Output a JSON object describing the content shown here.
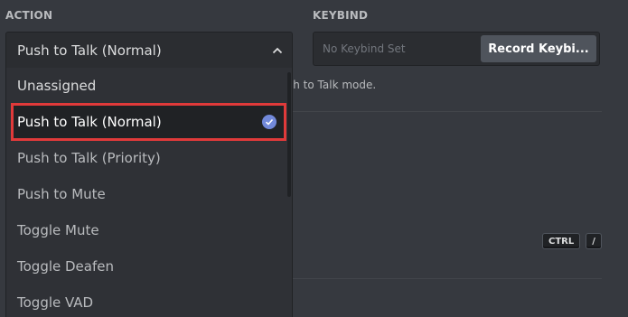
{
  "labels": {
    "action": "ACTION",
    "keybind": "KEYBIND"
  },
  "action_select": {
    "selected_value": "Push to Talk (Normal)",
    "options": [
      {
        "label": "Unassigned"
      },
      {
        "label": "Push to Talk (Normal)",
        "selected": true
      },
      {
        "label": "Push to Talk (Priority)"
      },
      {
        "label": "Push to Mute"
      },
      {
        "label": "Toggle Mute"
      },
      {
        "label": "Toggle Deafen"
      },
      {
        "label": "Toggle VAD"
      }
    ]
  },
  "keybind": {
    "placeholder": "No Keybind Set",
    "record_label": "Record Keybi..."
  },
  "note": "sh to Talk mode.",
  "shortcut_keys": [
    "CTRL",
    "/"
  ],
  "colors": {
    "background": "#36393f",
    "check": "#7289da",
    "highlight_outline": "#e03a3a"
  }
}
